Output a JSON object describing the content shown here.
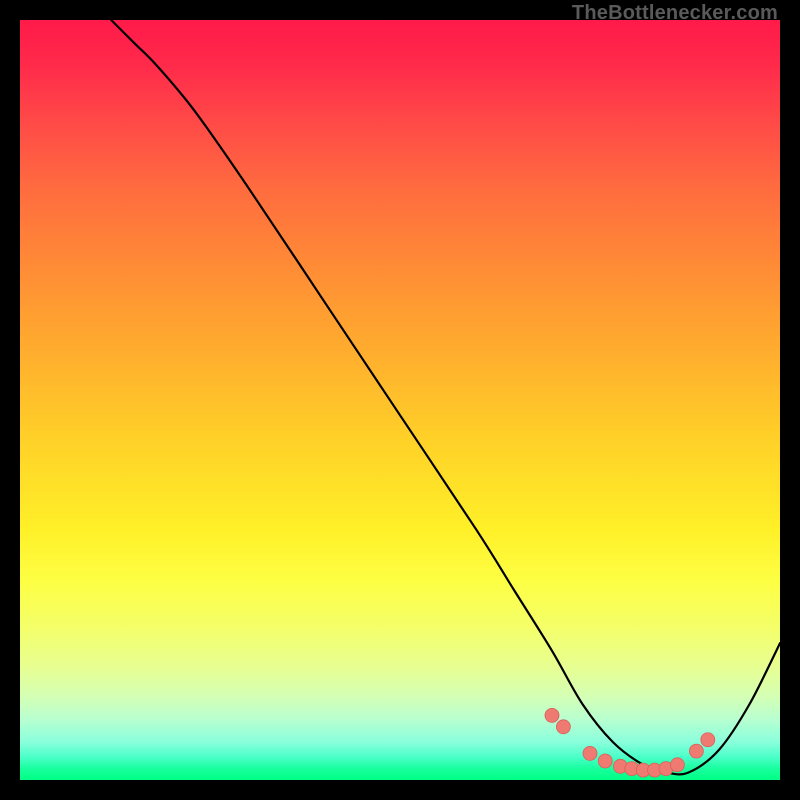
{
  "watermark": "TheBottlenecker.com",
  "chart_data": {
    "type": "line",
    "title": "",
    "xlabel": "",
    "ylabel": "",
    "xlim": [
      0,
      100
    ],
    "ylim": [
      0,
      100
    ],
    "background_gradient": {
      "top": "#ff1a4a",
      "bottom": "#00ff84",
      "note": "vertical red→yellow→green gradient"
    },
    "series": [
      {
        "name": "bottleneck-curve",
        "color": "#000000",
        "x": [
          12,
          15,
          18,
          23,
          30,
          40,
          50,
          60,
          65,
          70,
          74,
          78,
          82,
          85,
          88,
          92,
          96,
          100
        ],
        "y": [
          100,
          97,
          94,
          88,
          78,
          63,
          48,
          33,
          25,
          17,
          10,
          5,
          2,
          1,
          1,
          4,
          10,
          18
        ]
      }
    ],
    "markers": {
      "name": "highlight-points",
      "color": "#ef7a71",
      "x": [
        70,
        71.5,
        75,
        77,
        79,
        80.5,
        82,
        83.5,
        85,
        86.5,
        89,
        90.5
      ],
      "y": [
        8.5,
        7,
        3.5,
        2.5,
        1.8,
        1.5,
        1.3,
        1.3,
        1.5,
        2,
        3.8,
        5.3
      ]
    }
  }
}
